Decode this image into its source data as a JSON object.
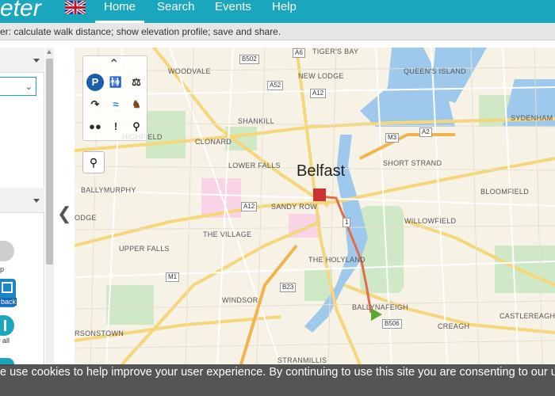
{
  "app": {
    "logo_text": "eter",
    "language_flag": "uk-flag-icon"
  },
  "nav": {
    "home": "Home",
    "search": "Search",
    "events": "Events",
    "help": "Help"
  },
  "subheader": {
    "text": "er: calculate walk distance; show elevation profile; save and share."
  },
  "left_panel": {
    "feedback_label": "back",
    "all_label": "all",
    "p_label": "p"
  },
  "map": {
    "city": "Belfast",
    "places": [
      {
        "name": "TIGER'S BAY"
      },
      {
        "name": "WOODVALE"
      },
      {
        "name": "NEW LODGE"
      },
      {
        "name": "QUEEN'S ISLAND"
      },
      {
        "name": "SHANKILL"
      },
      {
        "name": "SYDENHAM"
      },
      {
        "name": "HIGHFIELD"
      },
      {
        "name": "CLONARD"
      },
      {
        "name": "LOWER FALLS"
      },
      {
        "name": "SHORT STRAND"
      },
      {
        "name": "BALLYMURPHY"
      },
      {
        "name": "BLOOMFIELD"
      },
      {
        "name": "SANDY ROW"
      },
      {
        "name": "WILLOWFIELD"
      },
      {
        "name": "ODGE"
      },
      {
        "name": "THE VILLAGE"
      },
      {
        "name": "UPPER FALLS"
      },
      {
        "name": "THE HOLYLAND"
      },
      {
        "name": "WINDSOR"
      },
      {
        "name": "BALLYNAFEIGH"
      },
      {
        "name": "CASTLEREAGH"
      },
      {
        "name": "RSONSTOWN"
      },
      {
        "name": "CREAGH"
      },
      {
        "name": "STRANMILLIS"
      }
    ],
    "roads": [
      "B502",
      "A6",
      "A52",
      "A12",
      "M3",
      "A2",
      "A12",
      "1",
      "M1",
      "B23",
      "B506"
    ]
  },
  "toolbox": {
    "icons": [
      "parking-icon",
      "toilets-icon",
      "restaurant-icon",
      "route-icon",
      "water-icon",
      "horse-icon",
      "group-icon",
      "alert-icon",
      "pin-icon"
    ],
    "collapse_icon": "chevron-up-icon"
  },
  "cookie": {
    "text": "e use cookies to help improve your user experience. By continuing to use this site you are consenting to our us"
  }
}
